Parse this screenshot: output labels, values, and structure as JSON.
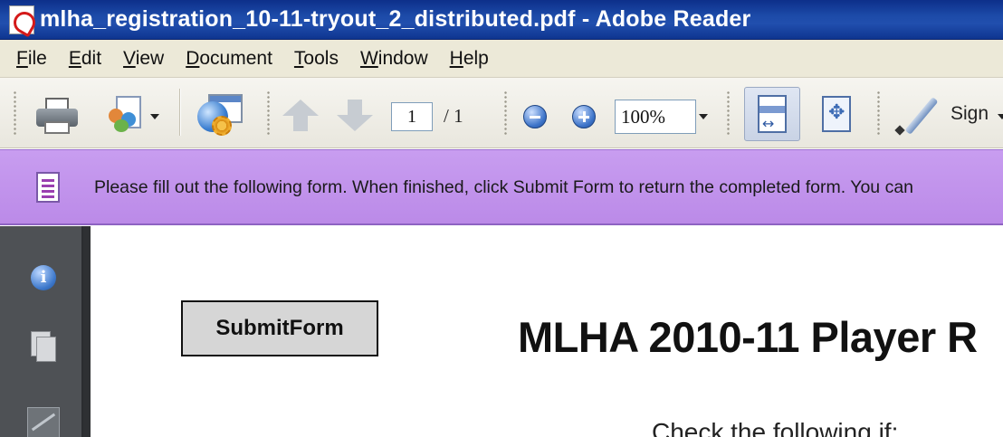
{
  "window": {
    "title": "mlha_registration_10-11-tryout_2_distributed.pdf - Adobe Reader"
  },
  "menu": [
    {
      "label": "File",
      "u": "F",
      "rest": "ile"
    },
    {
      "label": "Edit",
      "u": "E",
      "rest": "dit"
    },
    {
      "label": "View",
      "u": "V",
      "rest": "iew"
    },
    {
      "label": "Document",
      "u": "D",
      "rest": "ocument"
    },
    {
      "label": "Tools",
      "u": "T",
      "rest": "ools"
    },
    {
      "label": "Window",
      "u": "W",
      "rest": "indow"
    },
    {
      "label": "Help",
      "u": "H",
      "rest": "elp"
    }
  ],
  "toolbar": {
    "page_current": "1",
    "page_total": "/ 1",
    "zoom": "100%",
    "sign_label": "Sign",
    "icons": [
      "printer-icon",
      "collaborate-icon",
      "web-settings-icon",
      "previous-page-icon",
      "next-page-icon",
      "zoom-out-icon",
      "zoom-in-icon",
      "fit-width-icon",
      "fit-page-icon",
      "sign-pen-icon"
    ]
  },
  "messagebar": {
    "text": "Please fill out the following form. When finished, click Submit Form to return the completed form. You can"
  },
  "document": {
    "submit_label": "SubmitForm",
    "title": "MLHA 2010-11 Player R",
    "subtitle": "Check the following if:"
  },
  "colors": {
    "titlebar": "#1c4aa8",
    "messagebar": "#c89df0",
    "navpanel": "#4e5155"
  }
}
